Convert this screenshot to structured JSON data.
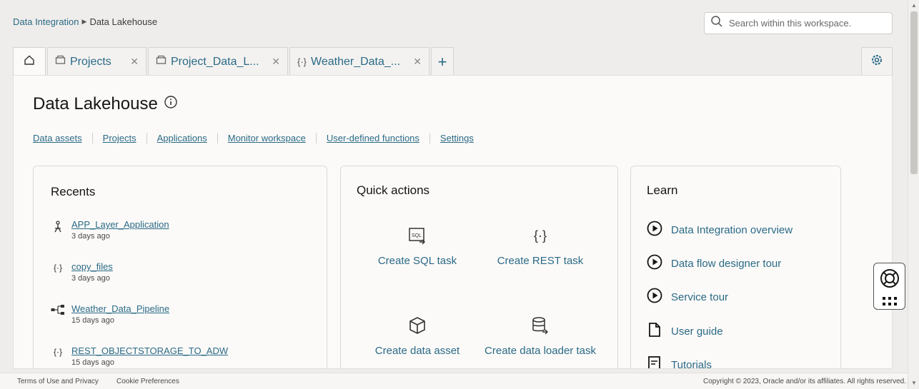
{
  "breadcrumb": {
    "root": "Data Integration",
    "current": "Data Lakehouse"
  },
  "search": {
    "placeholder": "Search within this workspace."
  },
  "tabs": [
    {
      "label": "Projects",
      "icon": "folder-icon"
    },
    {
      "label": "Project_Data_L...",
      "icon": "folder-icon"
    },
    {
      "label": "Weather_Data_...",
      "icon": "braces-icon"
    }
  ],
  "page": {
    "title": "Data Lakehouse"
  },
  "nav_links": [
    "Data assets",
    "Projects",
    "Applications",
    "Monitor workspace",
    "User-defined functions",
    "Settings"
  ],
  "recents": {
    "title": "Recents",
    "items": [
      {
        "name": "APP_Layer_Application",
        "time": "3 days ago",
        "icon": "application-icon"
      },
      {
        "name": "copy_files",
        "time": "3 days ago",
        "icon": "rest-task-icon"
      },
      {
        "name": "Weather_Data_Pipeline",
        "time": "15 days ago",
        "icon": "pipeline-icon"
      },
      {
        "name": "REST_OBJECTSTORAGE_TO_ADW",
        "time": "15 days ago",
        "icon": "rest-task-icon"
      }
    ]
  },
  "quick_actions": {
    "title": "Quick actions",
    "items": [
      "Create SQL task",
      "Create REST task",
      "Create data asset",
      "Create data loader task"
    ]
  },
  "learn": {
    "title": "Learn",
    "items": [
      "Data Integration overview",
      "Data flow designer tour",
      "Service tour",
      "User guide",
      "Tutorials"
    ]
  },
  "footer": {
    "terms": "Terms of Use and Privacy",
    "cookies": "Cookie Preferences",
    "copyright": "Copyright © 2023, Oracle and/or its affiliates. All rights reserved."
  },
  "colors": {
    "link": "#2b6a87",
    "background": "#eeedeb",
    "panel": "#fbfaf8"
  }
}
